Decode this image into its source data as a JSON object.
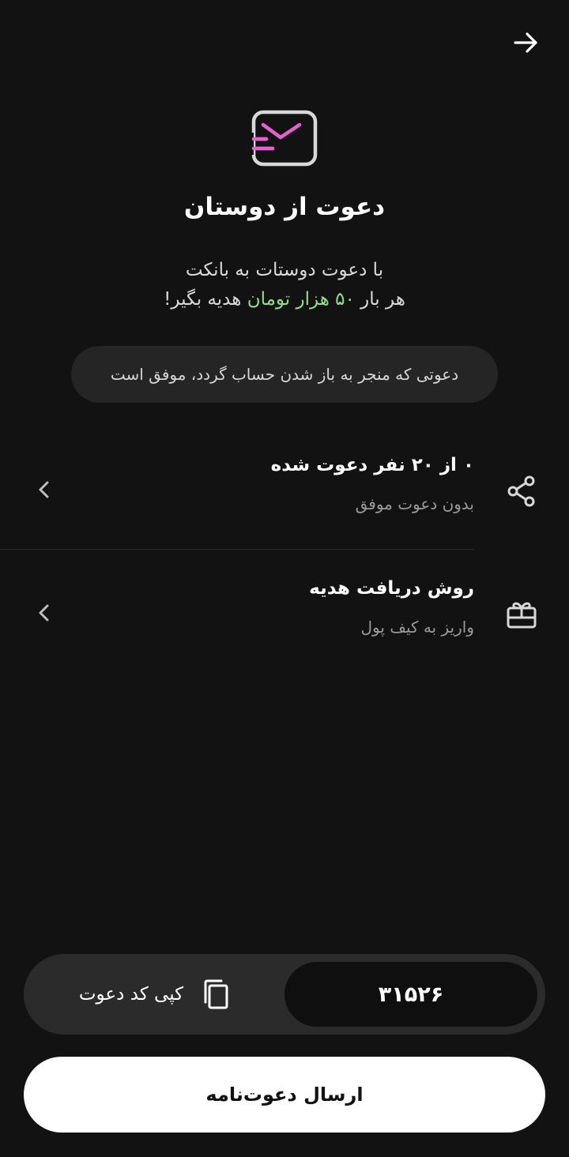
{
  "header": {
    "back_icon": "arrow-right-icon",
    "hero_icon": "envelope-send-icon"
  },
  "title": "دعوت از دوستان",
  "subtitle": {
    "line1": "با دعوت دوستات به بانکت",
    "line2_before": "هر بار ",
    "line2_highlight": "۵۰ هزار تومان",
    "line2_after": " هدیه بگیر!",
    "highlight_color": "#8fe08a"
  },
  "info_pill": {
    "text": "دعوتی که منجر به باز شدن حساب گردد، موفق است"
  },
  "rows": [
    {
      "icon": "share-icon",
      "title": "۰ از ۲۰ نفر دعوت شده",
      "subtitle": "بدون دعوت موفق"
    },
    {
      "icon": "gift-icon",
      "title": "روش دریافت هدیه",
      "subtitle": "واریز به کیف پول"
    }
  ],
  "invite_code": {
    "code": "۳۱۵۲۶",
    "copy_label": "کپی کد دعوت",
    "copy_icon": "copy-icon"
  },
  "send_button": {
    "label": "ارسال دعوت‌نامه"
  },
  "colors": {
    "background": "#121212",
    "accent_pink": "#e85fd4",
    "highlight_green": "#8fe08a"
  }
}
